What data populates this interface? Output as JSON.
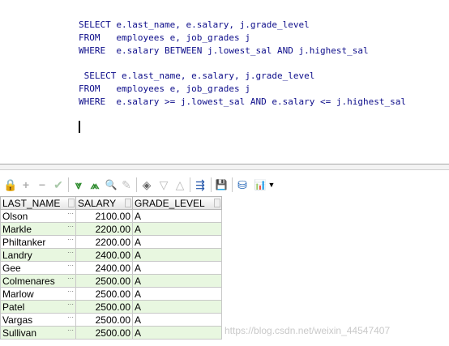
{
  "editor": {
    "lines": [
      "SELECT e.last_name, e.salary, j.grade_level",
      "FROM   employees e, job_grades j",
      "WHERE  e.salary BETWEEN j.lowest_sal AND j.highest_sal",
      " SELECT e.last_name, e.salary, j.grade_level",
      "FROM   employees e, job_grades j",
      "WHERE  e.salary >= j.lowest_sal AND e.salary <= j.highest_sal"
    ]
  },
  "toolbar": {
    "buttons": [
      {
        "name": "lock-icon",
        "glyph": "🔒"
      },
      {
        "name": "add-row-icon",
        "glyph": "+"
      },
      {
        "name": "delete-row-icon",
        "glyph": "−"
      },
      {
        "name": "post-icon",
        "glyph": "✔"
      },
      {
        "name": "filter-down-icon",
        "glyph": "⩔"
      },
      {
        "name": "filter-all-icon",
        "glyph": "⩕"
      },
      {
        "name": "find-icon",
        "glyph": "🔍"
      },
      {
        "name": "clear-icon",
        "glyph": "✎"
      },
      {
        "name": "query-icon",
        "glyph": "◈"
      },
      {
        "name": "next-icon",
        "glyph": "▽"
      },
      {
        "name": "prev-icon",
        "glyph": "△"
      },
      {
        "name": "export-icon",
        "glyph": "⇶"
      },
      {
        "name": "save-icon",
        "glyph": "💾"
      },
      {
        "name": "database-icon",
        "glyph": "⛁"
      },
      {
        "name": "chart-icon",
        "glyph": "📊"
      }
    ],
    "colors": {
      "accent_green": "#2e8b2e",
      "disabled": "#b0b0b0"
    }
  },
  "grid": {
    "columns": [
      "LAST_NAME",
      "SALARY",
      "GRADE_LEVEL"
    ],
    "ellipsis": "···",
    "rows": [
      [
        "Olson",
        "2100.00",
        "A"
      ],
      [
        "Markle",
        "2200.00",
        "A"
      ],
      [
        "Philtanker",
        "2200.00",
        "A"
      ],
      [
        "Landry",
        "2400.00",
        "A"
      ],
      [
        "Gee",
        "2400.00",
        "A"
      ],
      [
        "Colmenares",
        "2500.00",
        "A"
      ],
      [
        "Marlow",
        "2500.00",
        "A"
      ],
      [
        "Patel",
        "2500.00",
        "A"
      ],
      [
        "Vargas",
        "2500.00",
        "A"
      ],
      [
        "Sullivan",
        "2500.00",
        "A"
      ]
    ]
  },
  "watermark": "https://blog.csdn.net/weixin_44547407"
}
